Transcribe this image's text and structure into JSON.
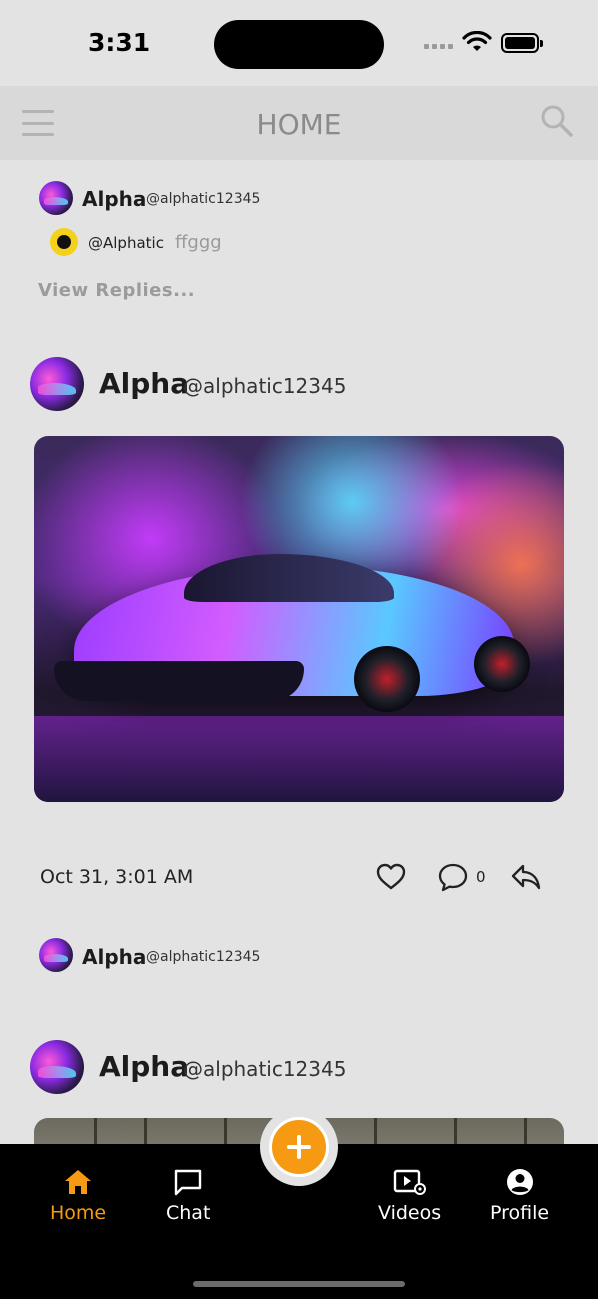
{
  "status_bar": {
    "time": "3:31"
  },
  "header": {
    "title": "HOME"
  },
  "comment_preview": {
    "name": "Alpha",
    "handle": "@alphatic12345",
    "reply": {
      "handle": "@Alphatic",
      "text": "ffggg"
    },
    "view_replies": "View Replies..."
  },
  "post": {
    "name": "Alpha",
    "handle": "@alphatic12345",
    "date": "Oct 31, 3:01 AM",
    "comment_count": "0",
    "comment_author": {
      "name": "Alpha",
      "handle": "@alphatic12345"
    }
  },
  "next_post": {
    "name": "Alpha",
    "handle": "@alphatic12345"
  },
  "nav": {
    "home": "Home",
    "chat": "Chat",
    "videos": "Videos",
    "profile": "Profile"
  },
  "colors": {
    "accent": "#f59a12",
    "background": "#e3e3e3",
    "nav_background": "#000000"
  },
  "icons": [
    "menu-icon",
    "search-icon",
    "heart-icon",
    "comment-icon",
    "share-icon",
    "home-icon",
    "chat-icon",
    "videos-icon",
    "profile-icon",
    "plus-icon"
  ]
}
